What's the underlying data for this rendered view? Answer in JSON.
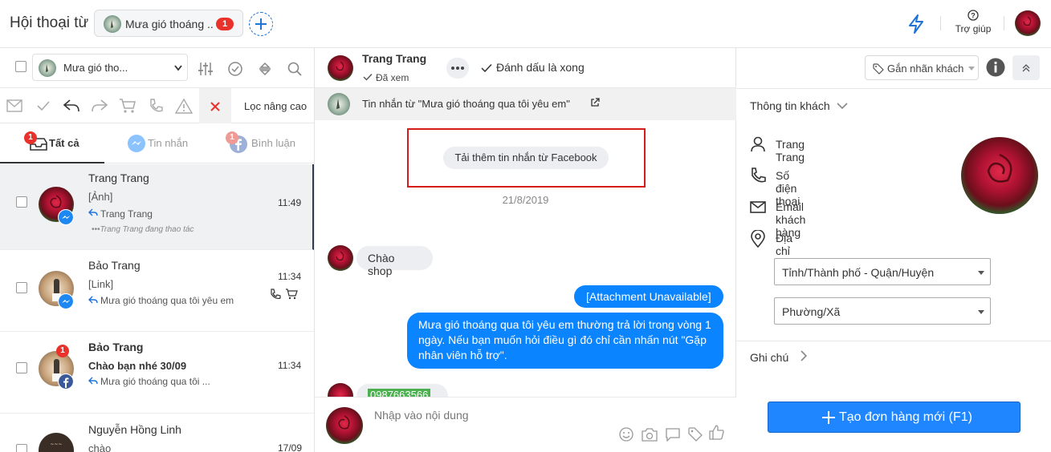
{
  "topbar": {
    "title": "Hội thoại từ",
    "page_chip_label": "Mưa gió thoáng ..",
    "page_chip_badge": "1",
    "help_label": "Trợ giúp"
  },
  "left": {
    "page_select_label": "Mưa gió tho...",
    "advanced_filter_label": "Lọc nâng cao",
    "tabs": [
      {
        "label": "Tất cả",
        "badge": "1"
      },
      {
        "label": "Tin nhắn"
      },
      {
        "label": "Bình luận",
        "badge": "1"
      }
    ],
    "conversations": [
      {
        "name": "Trang Trang",
        "preview": "[Ảnh]",
        "reply": "Trang Trang",
        "typing": "•••Trang Trang đang thao tác",
        "time": "11:49",
        "source": "messenger"
      },
      {
        "name": "Bảo Trang",
        "preview": "[Link]",
        "reply": "Mưa gió thoáng qua tôi yêu em",
        "time": "11:34",
        "source": "messenger"
      },
      {
        "name": "Bảo Trang",
        "preview": "Chào bạn nhé 30/09",
        "reply": "Mưa gió thoáng qua tôi ...",
        "time": "11:34",
        "source": "facebook",
        "badge": "1"
      },
      {
        "name": "Nguyễn Hồng Linh",
        "preview": "chào",
        "time": "17/09"
      }
    ]
  },
  "chat": {
    "contact_name": "Trang Trang",
    "seen_label": "Đã xem",
    "mark_done_label": "Đánh dấu là xong",
    "source_text": "Tin nhắn từ  \"Mưa gió thoáng qua tôi yêu em\"",
    "load_more_label": "Tải thêm tin nhắn từ Facebook",
    "date": "21/8/2019",
    "messages": [
      {
        "dir": "in",
        "text": "Chào shop"
      },
      {
        "dir": "out",
        "text": "[Attachment Unavailable]"
      },
      {
        "dir": "out",
        "lines": [
          "Mưa gió thoáng qua tôi yêu em thường trả lời trong vòng 1",
          "ngày. Nếu bạn muốn hỏi điều gì đó chỉ cần nhấn nút \"Gặp",
          "nhân viên hỗ trợ\"."
        ]
      },
      {
        "dir": "in",
        "text": "0987663566"
      }
    ],
    "composer_placeholder": "Nhập vào nội dung"
  },
  "right": {
    "tag_label": "Gắn nhãn khách",
    "info_title": "Thông tin khách",
    "customer_name": "Trang Trang",
    "phone_label": "Số điện thoại",
    "email_label": "Email khách hàng",
    "address_label": "Địa chỉ",
    "province_select": "Tỉnh/Thành phố - Quận/Huyện",
    "ward_select": "Phường/Xã",
    "note_label": "Ghi chú",
    "create_order_label": "Tạo đơn hàng mới (F1)"
  },
  "colors": {
    "accent": "#1e72d8",
    "badge_red": "#e8322b",
    "bubble_out": "#0a84ff",
    "order_button": "#1f86ff",
    "phone_highlight": "#4caf50"
  }
}
